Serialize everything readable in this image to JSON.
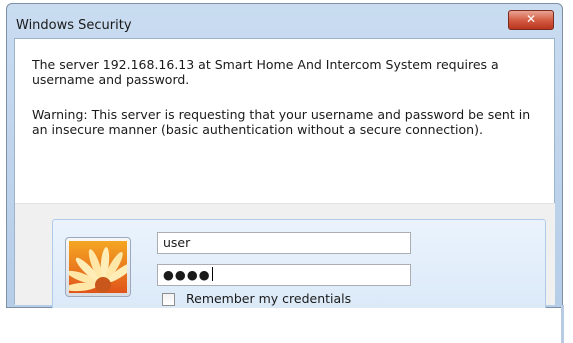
{
  "window": {
    "title": "Windows Security",
    "close_glyph": "✕",
    "close_icon": "close-icon"
  },
  "message": {
    "text": "The server 192.168.16.13 at Smart Home And Intercom System requires a username and password.",
    "warning": "Warning: This server is requesting that your username and password be sent in an insecure manner (basic authentication without a secure connection)."
  },
  "credentials": {
    "avatar_icon": "user-picture-flower-icon",
    "username_value": "user",
    "password_value": "●●●●",
    "remember_label": "Remember my credentials",
    "remember_checked": false
  },
  "colors": {
    "close_button": "#d2583f",
    "title_bar": "#c9dcf0",
    "tile": "#dbe9f8"
  }
}
